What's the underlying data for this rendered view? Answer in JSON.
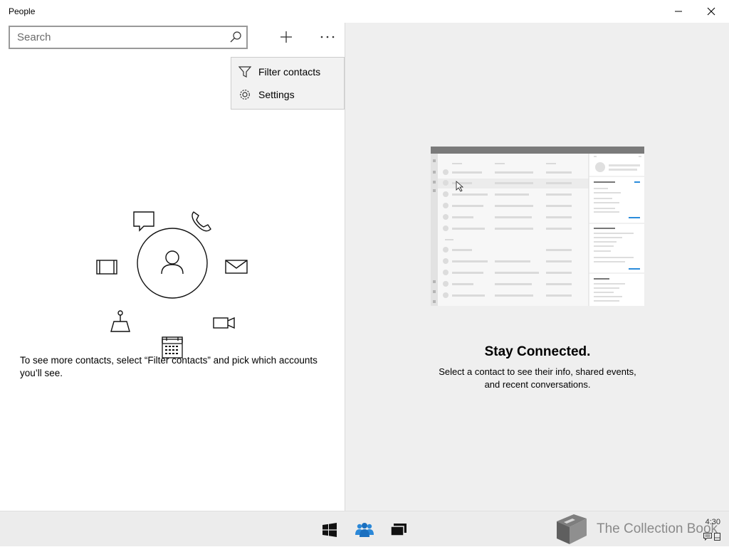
{
  "window": {
    "title": "People"
  },
  "search": {
    "placeholder": "Search",
    "value": ""
  },
  "toolbar": {
    "add_icon": "plus-icon",
    "more_icon": "ellipsis-icon"
  },
  "flyout": {
    "items": [
      {
        "label": "Filter contacts",
        "icon": "filter-icon"
      },
      {
        "label": "Settings",
        "icon": "gear-icon"
      }
    ]
  },
  "left": {
    "hint": "To see more contacts, select “Filter contacts” and pick which accounts you’ll see."
  },
  "right": {
    "title": "Stay Connected.",
    "text": "Select a contact to see their info, shared events, and recent conversations."
  },
  "taskbar": {
    "watermark": "The Collection Book",
    "clock": "4:30"
  },
  "colors": {
    "accent": "#0078d7",
    "pane_bg": "#efefef",
    "taskbar_bg": "#ececec"
  }
}
